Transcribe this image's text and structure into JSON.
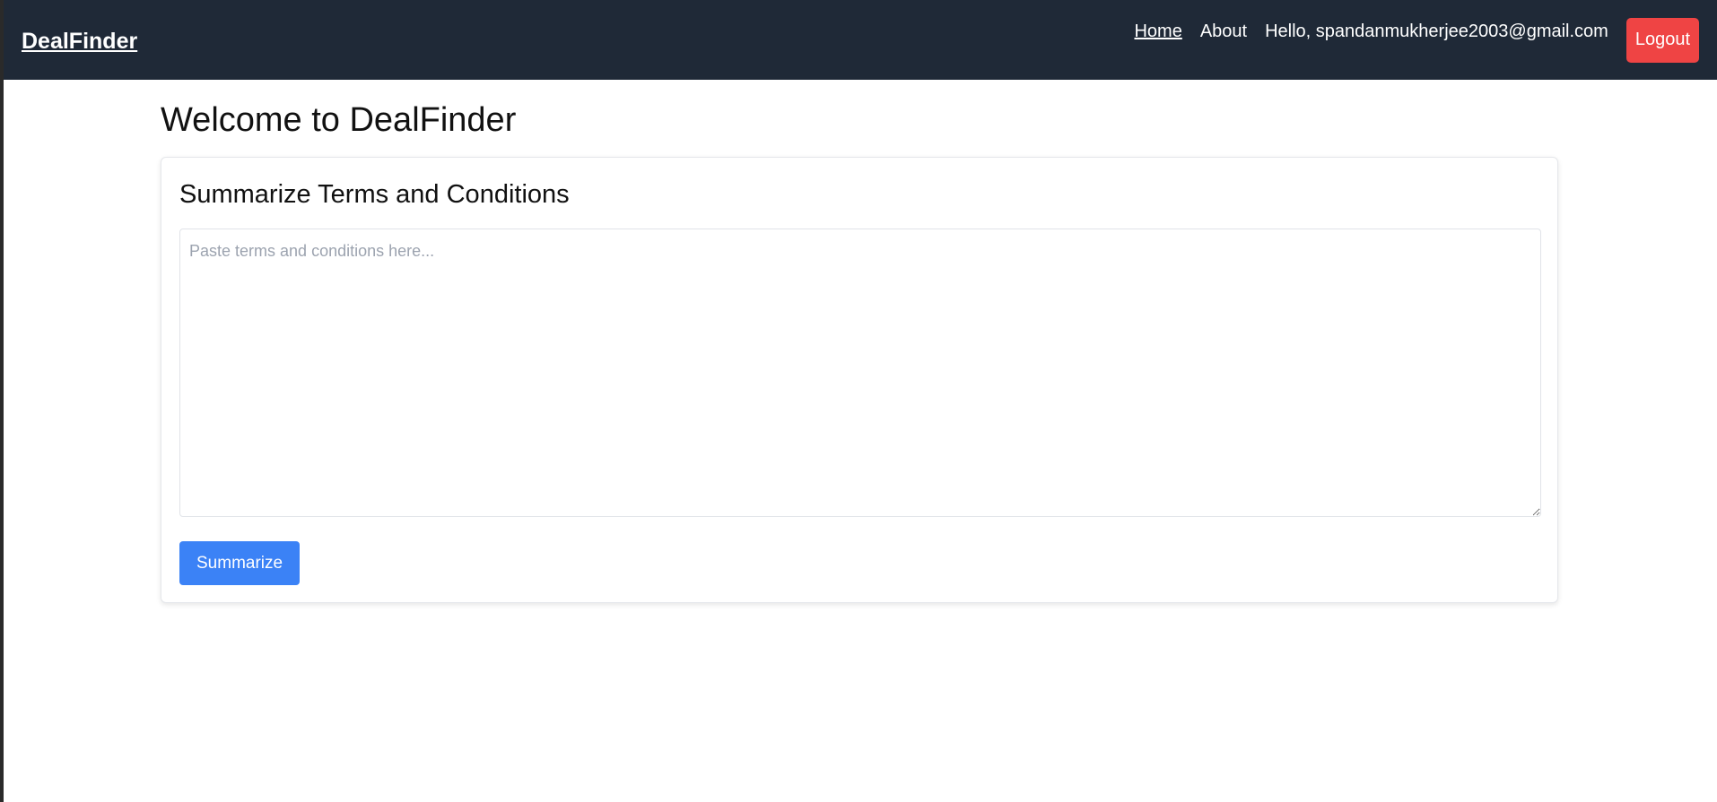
{
  "navbar": {
    "brand": "DealFinder",
    "links": [
      {
        "label": "Home",
        "active": true
      },
      {
        "label": "About",
        "active": false
      }
    ],
    "greeting": "Hello, spandanmukherjee2003@gmail.com",
    "logout_label": "Logout"
  },
  "main": {
    "title": "Welcome to DealFinder",
    "card": {
      "title": "Summarize Terms and Conditions",
      "textarea_placeholder": "Paste terms and conditions here...",
      "textarea_value": "",
      "submit_label": "Summarize"
    }
  },
  "colors": {
    "navbar_bg": "#1f2937",
    "logout_bg": "#ef4444",
    "primary": "#3b82f6"
  }
}
